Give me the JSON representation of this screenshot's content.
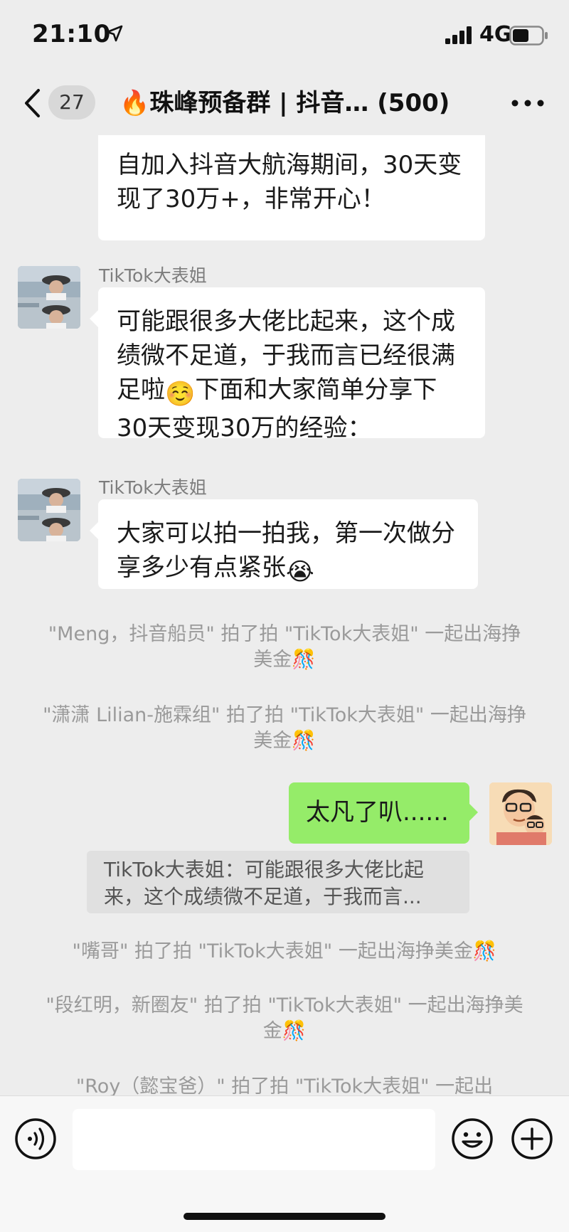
{
  "status_bar": {
    "time": "21:10",
    "network": "4G"
  },
  "nav": {
    "unread_count": "27",
    "title": "🔥珠峰预备群 | 抖音…  (500)"
  },
  "messages": {
    "m1": {
      "text": "自加入抖音大航海期间，30天变现了30万+，非常开心！"
    },
    "m2": {
      "sender": "TikTok大表姐",
      "text_before": "可能跟很多大佬比起来，这个成绩微不足道，于我而言已经很满足啦",
      "emoji": "☺️",
      "text_after": "下面和大家简单分享下30天变现30万的经验："
    },
    "m3": {
      "sender": "TikTok大表姐",
      "text": "大家可以拍一拍我，第一次做分享多少有点紧张",
      "emoji": "😭"
    },
    "sys1": {
      "text": "\"Meng，抖音船员\" 拍了拍 \"TikTok大表姐\" 一起出海挣美金",
      "emoji": "🎊"
    },
    "sys2": {
      "text": "\"潇潇 Lilian-施霖组\" 拍了拍 \"TikTok大表姐\" 一起出海挣美金",
      "emoji": "🎊"
    },
    "m4": {
      "text": "太凡了叭......"
    },
    "quote": {
      "text": "TikTok大表姐：可能跟很多大佬比起来，这个成绩微不足道，于我而言..."
    },
    "sys3": {
      "text": "\"嘴哥\" 拍了拍 \"TikTok大表姐\" 一起出海挣美金",
      "emoji": "🎊"
    },
    "sys4": {
      "text": "\"段红明，新圈友\" 拍了拍 \"TikTok大表姐\" 一起出海挣美金",
      "emoji": "🎊"
    },
    "sys5": {
      "text": "\"Roy（懿宝爸）\" 拍了拍 \"TikTok大表姐\" 一起出"
    }
  },
  "input": {
    "value": ""
  }
}
